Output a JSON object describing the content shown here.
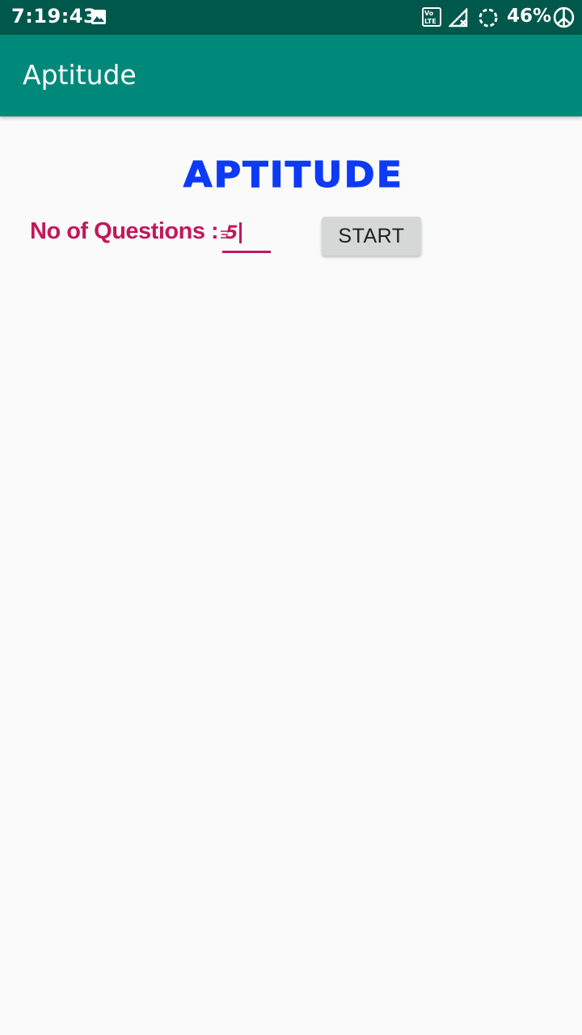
{
  "status_bar": {
    "time": "7:19:43",
    "battery_percent": "46%",
    "icons": [
      "image-icon",
      "volte-icon",
      "signal-icon",
      "sync-icon",
      "peace-icon"
    ]
  },
  "app_bar": {
    "title": "Aptitude",
    "background_color": "#00897b"
  },
  "main": {
    "heading": "APTITUDE",
    "heading_color": "#0d3bf5",
    "questions_label": "No of Questions :",
    "questions_value": "5",
    "accent_color": "#c2185b",
    "start_label": "START"
  }
}
